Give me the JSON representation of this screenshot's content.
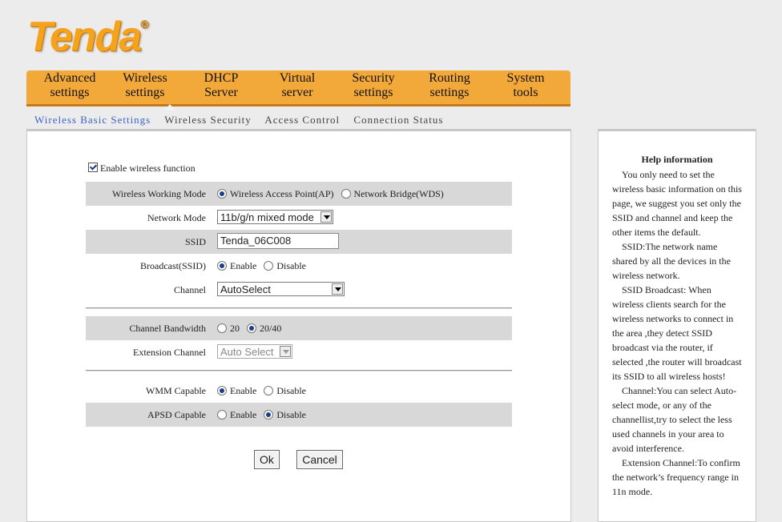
{
  "brand": {
    "logo_text": "Tenda",
    "reg_mark": "®"
  },
  "nav": {
    "items": [
      {
        "line1": "Advanced",
        "line2": "settings"
      },
      {
        "line1": "Wireless",
        "line2": "settings"
      },
      {
        "line1": "DHCP",
        "line2": "Server"
      },
      {
        "line1": "Virtual",
        "line2": "server"
      },
      {
        "line1": "Security",
        "line2": "settings"
      },
      {
        "line1": "Routing",
        "line2": "settings"
      },
      {
        "line1": "System",
        "line2": "tools"
      }
    ],
    "active_index": 1,
    "color": "#f3a83a"
  },
  "subnav": {
    "items": [
      "Wireless Basic Settings",
      "Wireless Security",
      "Access Control",
      "Connection Status"
    ],
    "active_color": "#3a64c8"
  },
  "form": {
    "enable_wireless": {
      "label": "Enable wireless function",
      "checked": true
    },
    "working_mode": {
      "label": "Wireless Working Mode",
      "opt1": "Wireless Access Point(AP)",
      "opt2": "Network Bridge(WDS)",
      "selected": "opt1"
    },
    "network_mode": {
      "label": "Network Mode",
      "value": "11b/g/n mixed mode"
    },
    "ssid": {
      "label": "SSID",
      "value": "Tenda_06C008"
    },
    "broadcast": {
      "label": "Broadcast(SSID)",
      "opt1": "Enable",
      "opt2": "Disable",
      "selected": "opt1"
    },
    "channel": {
      "label": "Channel",
      "value": "AutoSelect"
    },
    "bandwidth": {
      "label": "Channel Bandwidth",
      "opt1": "20",
      "opt2": "20/40",
      "selected": "opt2"
    },
    "extension": {
      "label": "Extension Channel",
      "value": "Auto Select"
    },
    "wmm": {
      "label": "WMM Capable",
      "opt1": "Enable",
      "opt2": "Disable",
      "selected": "opt1"
    },
    "apsd": {
      "label": "APSD Capable",
      "opt1": "Enable",
      "opt2": "Disable",
      "selected": "opt2"
    },
    "ok_label": "Ok",
    "cancel_label": "Cancel"
  },
  "help": {
    "title": "Help information",
    "paragraphs": [
      "You only need to set the wireless basic information on this page, we suggest you set only the SSID and channel and keep the other items the default.",
      "SSID:The network name shared by all the devices in the wireless network.",
      "SSID Broadcast: When wireless clients search for the wireless networks to connect in the area ,they detect SSID broadcast via the router, if selected ,the router will broadcast its SSID to all wireless hosts!",
      "Channel:You can select Auto-select mode, or any of the channellist,try to select the less used channels in your area to avoid interference.",
      "Extension Channel:To confirm the network’s frequency range in 11n mode."
    ]
  }
}
